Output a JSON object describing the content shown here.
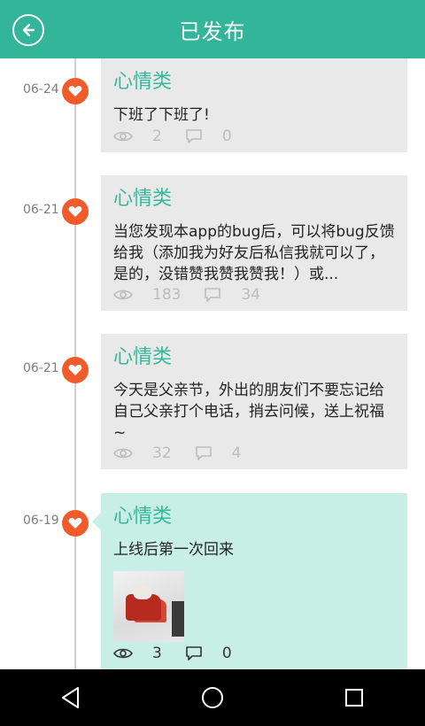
{
  "header": {
    "title": "已发布"
  },
  "entries": [
    {
      "date": "06-24",
      "category": "心情类",
      "content": "下班了下班了!",
      "views": "2",
      "comments": "0"
    },
    {
      "date": "06-21",
      "category": "心情类",
      "content": "当您发现本app的bug后，可以将bug反馈给我（添加我为好友后私信我就可以了，是的，没错赞我赞我赞我！）或...",
      "views": "183",
      "comments": "34"
    },
    {
      "date": "06-21",
      "category": "心情类",
      "content": "今天是父亲节，外出的朋友们不要忘记给自己父亲打个电话，捎去问候，送上祝福~",
      "views": "32",
      "comments": "4"
    },
    {
      "date": "06-19",
      "category": "心情类",
      "content": "上线后第一次回来",
      "views": "3",
      "comments": "0"
    }
  ],
  "colors": {
    "header": "#33b59a",
    "accent": "#35b89c",
    "heart": "#ef5b2a",
    "active_card": "#c8efe5"
  },
  "icons": {
    "back": "back-arrow-circle-icon",
    "heart": "heart-icon",
    "views": "eye-icon",
    "comments": "speech-bubble-icon"
  }
}
